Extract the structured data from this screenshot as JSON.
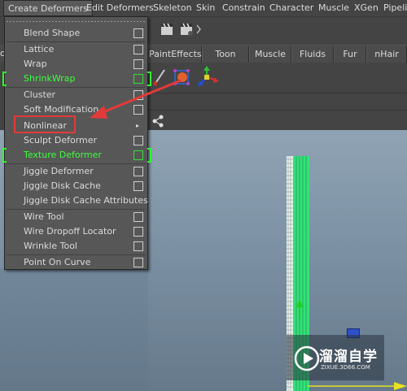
{
  "menubar": {
    "items": [
      "Create Deformers",
      "Edit Deformers",
      "Skeleton",
      "Skin",
      "Constrain",
      "Character",
      "Muscle",
      "XGen",
      "Pipeli"
    ]
  },
  "shelf": {
    "tabs": [
      "PaintEffects",
      "Toon",
      "Muscle",
      "Fluids",
      "Fur",
      "nHair"
    ],
    "left_partial_tab": "or"
  },
  "dropdown": {
    "items": [
      {
        "label": "Blend Shape",
        "option": true,
        "green": false
      },
      {
        "label": "Lattice",
        "option": true,
        "green": false
      },
      {
        "label": "Wrap",
        "option": true,
        "green": false
      },
      {
        "label": "ShrinkWrap",
        "option": true,
        "green": true
      },
      {
        "label": "Cluster",
        "option": true,
        "green": false
      },
      {
        "label": "Soft Modification",
        "option": true,
        "green": false
      },
      {
        "label": "Nonlinear",
        "option": false,
        "submenu": true,
        "green": false
      },
      {
        "label": "Sculpt Deformer",
        "option": true,
        "green": false
      },
      {
        "label": "Texture Deformer",
        "option": true,
        "green": true
      },
      {
        "label": "Jiggle Deformer",
        "option": true,
        "green": false
      },
      {
        "label": "Jiggle Disk Cache",
        "option": true,
        "green": false
      },
      {
        "label": "Jiggle Disk Cache Attributes",
        "option": false,
        "green": false
      },
      {
        "label": "Wire Tool",
        "option": true,
        "green": false
      },
      {
        "label": "Wire Dropoff Locator",
        "option": true,
        "green": false
      },
      {
        "label": "Wrinkle Tool",
        "option": true,
        "green": false
      },
      {
        "label": "Point On Curve",
        "option": true,
        "green": false
      }
    ]
  },
  "watermark": {
    "title": "溜溜自学",
    "subtitle": "ZIXUE.3D66.COM"
  },
  "colors": {
    "highlight_green": "#3dff3d",
    "annotation_red": "#e23a3a",
    "menu_bg": "#575757"
  }
}
